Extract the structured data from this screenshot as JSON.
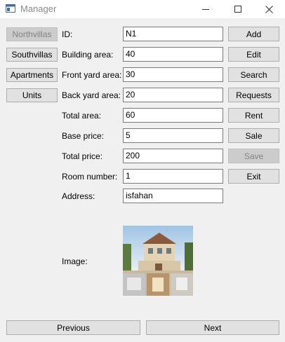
{
  "window": {
    "title": "Manager",
    "controls": {
      "minimize": "minimize-icon",
      "maximize": "maximize-icon",
      "close": "close-icon"
    }
  },
  "sidebar": {
    "items": [
      {
        "label": "Northvillas",
        "active": true
      },
      {
        "label": "Southvillas"
      },
      {
        "label": "Apartments"
      },
      {
        "label": "Units"
      }
    ]
  },
  "form": {
    "id": {
      "label": "ID:",
      "value": "N1"
    },
    "building_area": {
      "label": "Building area:",
      "value": "40"
    },
    "front_yard_area": {
      "label": "Front yard area:",
      "value": "30"
    },
    "back_yard_area": {
      "label": "Back yard area:",
      "value": "20"
    },
    "total_area": {
      "label": "Total area:",
      "value": "60"
    },
    "base_price": {
      "label": "Base price:",
      "value": "5"
    },
    "total_price": {
      "label": "Total price:",
      "value": "200"
    },
    "room_number": {
      "label": "Room number:",
      "value": "1"
    },
    "address": {
      "label": "Address:",
      "value": "isfahan"
    },
    "image": {
      "label": "Image:"
    }
  },
  "actions": {
    "add": "Add",
    "edit": "Edit",
    "search": "Search",
    "requests": "Requests",
    "rent": "Rent",
    "sale": "Sale",
    "save": "Save",
    "exit": "Exit"
  },
  "pager": {
    "previous": "Previous",
    "next": "Next"
  },
  "colors": {
    "window_bg": "#f0f0f0",
    "button_bg": "#e1e1e1",
    "button_border": "#adadad",
    "disabled_text": "#838383"
  }
}
